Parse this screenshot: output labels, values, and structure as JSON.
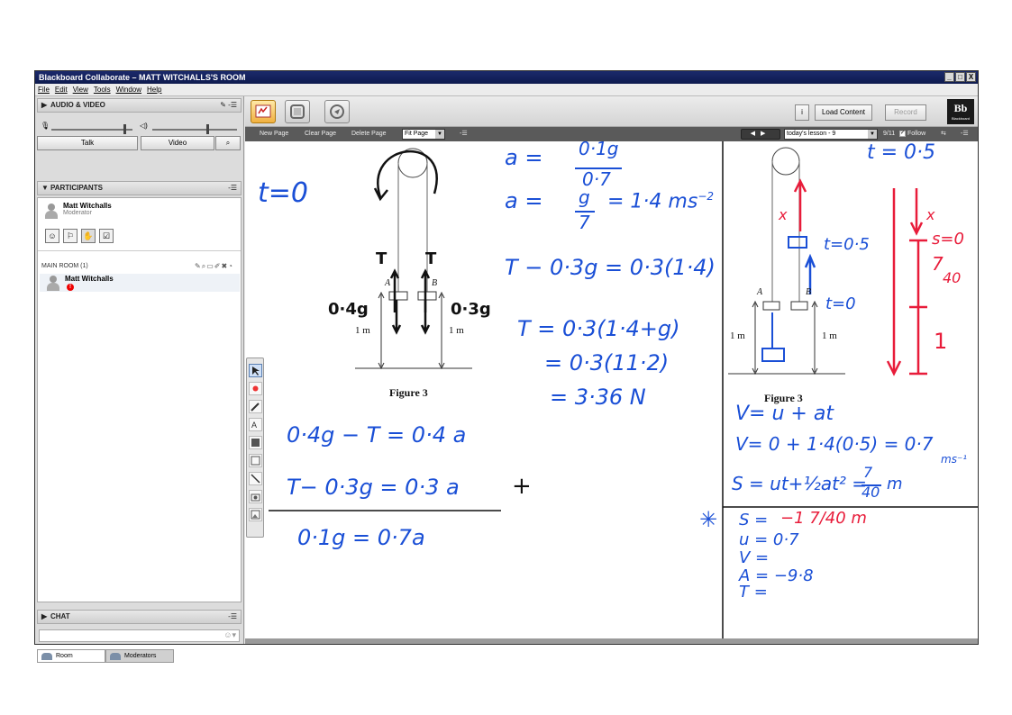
{
  "window": {
    "title": "Blackboard Collaborate – MATT WITCHALLS'S ROOM",
    "controls": [
      "_",
      "□",
      "X"
    ]
  },
  "menu": [
    "File",
    "Edit",
    "View",
    "Tools",
    "Window",
    "Help"
  ],
  "audio_video": {
    "header": "AUDIO & VIDEO",
    "talk_label": "Talk",
    "video_label": "Video"
  },
  "participants": {
    "header": "PARTICIPANTS",
    "self_name": "Matt Witchalls",
    "self_role": "Moderator",
    "room_label": "MAIN ROOM (1)",
    "room_user": "Matt Witchalls",
    "badge": "!"
  },
  "chat": {
    "header": "CHAT"
  },
  "tabs": [
    "Room",
    "Moderators"
  ],
  "toolbar": {
    "load_content": "Load Content",
    "record": "Record",
    "info": "i",
    "logo": "Bb",
    "logo_sub": "Blackboard"
  },
  "page_toolbar": {
    "new_page": "New Page",
    "clear_page": "Clear Page",
    "delete_page": "Delete Page",
    "fit": "Fit Page",
    "lesson": "today's lesson -  9",
    "page_count": "9/11",
    "follow": "Follow"
  },
  "board": {
    "left_fig": {
      "T1": "T",
      "T2": "T",
      "A": "A",
      "B": "B",
      "m1": "0·4g",
      "m2": "0·3g",
      "h1": "1 m",
      "h2": "1 m",
      "caption": "Figure 3",
      "t0": "t=0"
    },
    "eq_left": {
      "line1": "0·4g − T = 0·4 a",
      "line2": "T− 0·3g  =  0·3 a",
      "plus": "+",
      "line3": "0·1g    = 0·7a"
    },
    "eq_mid": {
      "a_eq": "a  =",
      "frac1_num": "0·1g",
      "frac1_den": "0·7",
      "a_eq2": "a  =",
      "frac2_num": "g",
      "frac2_den": "7",
      "result": "=  1·4 ms",
      "result_exp": "−2",
      "tension1": "T − 0·3g = 0·3(1·4)",
      "tension2": "T = 0·3(1·4+g)",
      "tension3": "= 0·3(11·2)",
      "tension4": "=  3·36 N"
    },
    "right_fig": {
      "t_label": "t = 0·5",
      "x1": "x",
      "x2": "x",
      "t05": "t=0·5",
      "t0": "t=0",
      "A": "A",
      "B": "B",
      "h1": "1 m",
      "h2": "1 m",
      "caption": "Figure 3",
      "s0": "s=0",
      "frac_num": "7",
      "frac_den": "40",
      "one": "1"
    },
    "eq_right": {
      "v1": "V= u + at",
      "v2": "V= 0 + 1·4(0·5) = 0·7",
      "v2_unit": "ms⁻¹",
      "s1": "S = ut+½at² =",
      "s_frac_num": "7",
      "s_frac_den": "40",
      "s_unit": "m"
    },
    "suvat": {
      "star": "✳",
      "s": "S =",
      "s_val": "−1 7/40 m",
      "u": "u = 0·7",
      "v": "V =",
      "a": "A = −9·8",
      "t": "T ="
    }
  },
  "colors": {
    "ink_blue": "#1a4fd6",
    "ink_red": "#e81c3a",
    "titlebar": "#1b2a6b"
  }
}
